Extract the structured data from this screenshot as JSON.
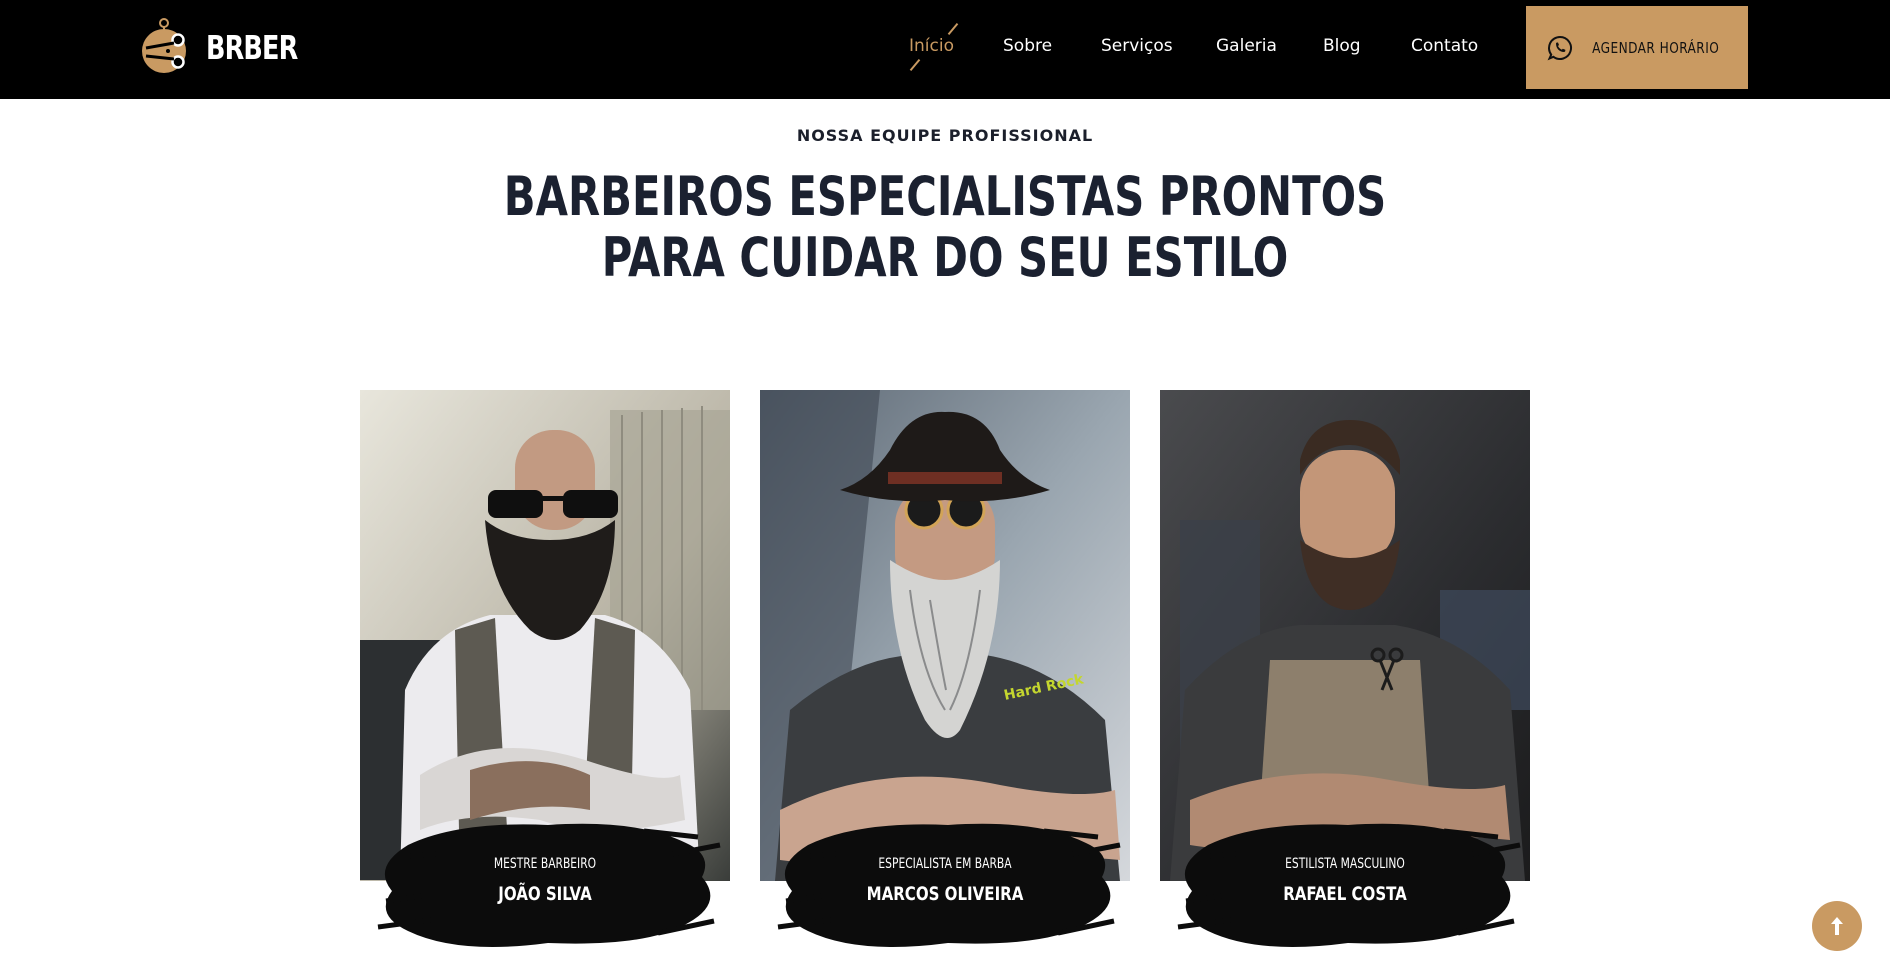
{
  "brand": {
    "name": "BRBER",
    "accent": "#c99a62"
  },
  "nav": {
    "items": [
      {
        "label": "Início",
        "active": true
      },
      {
        "label": "Sobre"
      },
      {
        "label": "Serviços"
      },
      {
        "label": "Galeria"
      },
      {
        "label": "Blog"
      },
      {
        "label": "Contato"
      }
    ],
    "cta_label": "AGENDAR HORÁRIO",
    "cta_icon": "whatsapp-icon"
  },
  "section": {
    "eyebrow": "NOSSA EQUIPE PROFISSIONAL",
    "title_line1": "BARBEIROS ESPECIALISTAS PRONTOS",
    "title_line2": "PARA CUIDAR DO SEU ESTILO"
  },
  "team": [
    {
      "role": "MESTRE BARBEIRO",
      "name": "JOÃO SILVA"
    },
    {
      "role": "ESPECIALISTA EM BARBA",
      "name": "MARCOS OLIVEIRA"
    },
    {
      "role": "ESTILISTA MASCULINO",
      "name": "RAFAEL COSTA"
    }
  ],
  "back_to_top_icon": "arrow-up-icon"
}
